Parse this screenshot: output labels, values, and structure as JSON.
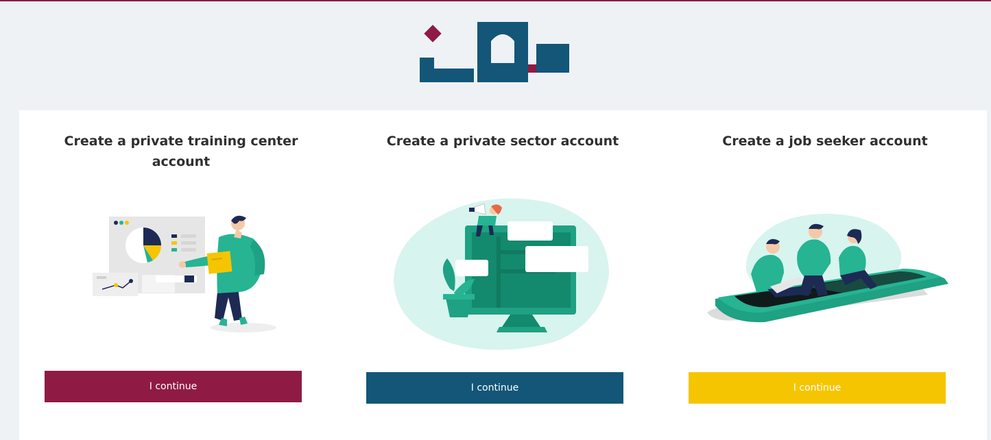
{
  "brand": {
    "logo_icon": "brand-logo-icon",
    "colors": {
      "maroon": "#8f1b45",
      "navy": "#135678",
      "gold": "#f6c501",
      "teal": "#26b493",
      "background": "#eef2f5"
    }
  },
  "cards": [
    {
      "title": "Create a private training center account",
      "illustration_icon": "presentation-chart-illustration",
      "button_label": "I continue",
      "button_color": "#8f1b45"
    },
    {
      "title": "Create a private sector account",
      "illustration_icon": "monitor-megaphone-illustration",
      "button_label": "I continue",
      "button_color": "#135678"
    },
    {
      "title": "Create a job seeker account",
      "illustration_icon": "people-on-phone-illustration",
      "button_label": "I continue",
      "button_color": "#f6c501"
    }
  ]
}
